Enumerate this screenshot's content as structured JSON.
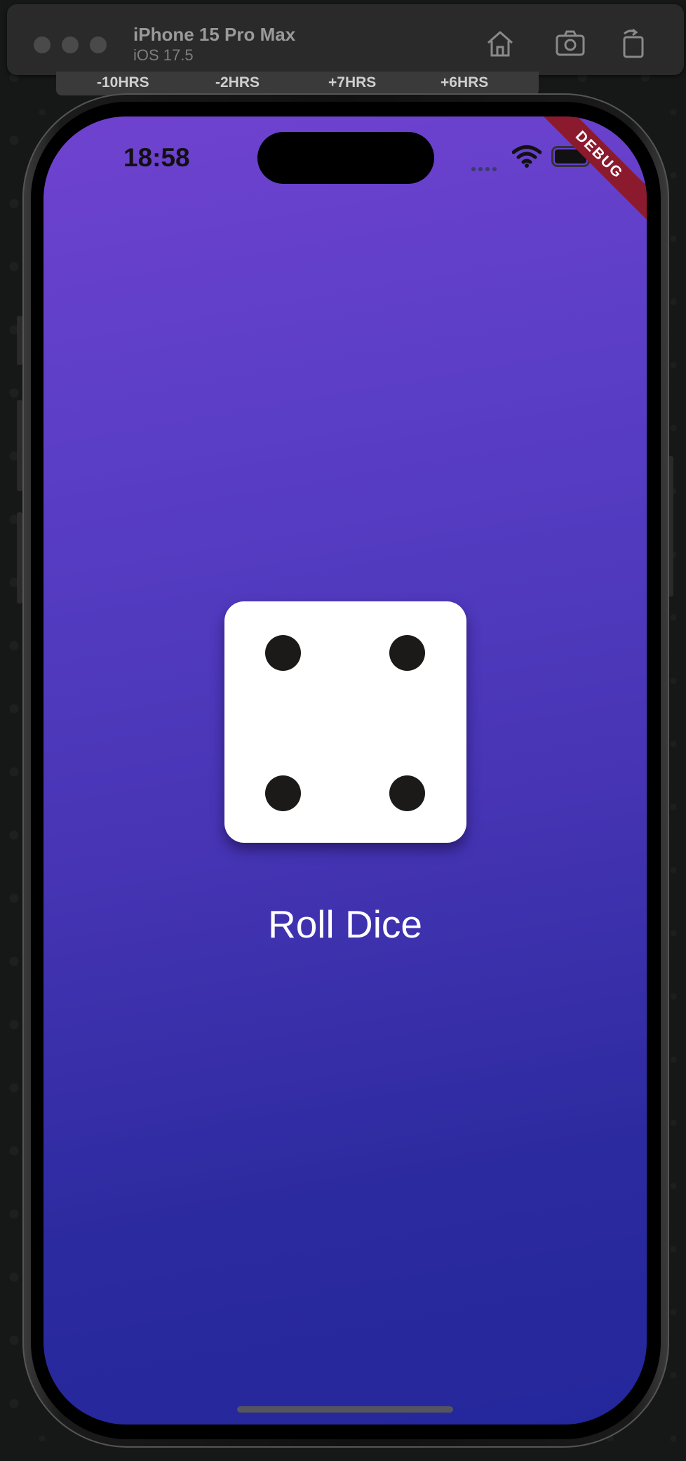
{
  "simulator": {
    "device_name": "iPhone 15 Pro Max",
    "os_version": "iOS 17.5",
    "home_icon": "home-icon",
    "screenshot_icon": "camera-icon",
    "rotate_icon": "rotate-icon"
  },
  "world_clock": {
    "offsets": [
      "-10HRS",
      "-2HRS",
      "+7HRS",
      "+6HRS"
    ]
  },
  "status_bar": {
    "time": "18:58"
  },
  "debug_banner": "DEBUG",
  "app": {
    "dice_value": 4,
    "roll_button_label": "Roll Dice",
    "colors": {
      "gradient_top": "#6f42cf",
      "gradient_bottom": "#24279b",
      "pip": "#1c1a18",
      "debug_ribbon": "#8b1a2e"
    }
  }
}
